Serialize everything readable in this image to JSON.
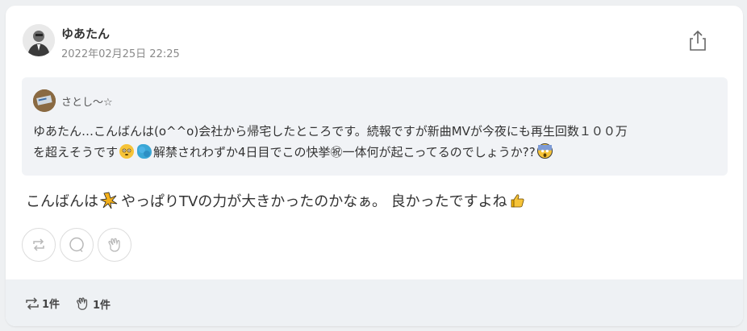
{
  "post": {
    "author_name": "ゆあたん",
    "date": "2022年02月25日 22:25",
    "reply_text_a": "こんばんは",
    "reply_text_b": "やっぱりTVの力が大きかったのかなぁ。 良かったですよね"
  },
  "quote": {
    "author_name": "さとし～☆",
    "text_line1": "ゆあたん…こんばんは(o^^o)会社から帰宅したところです。続報ですが新曲MVが今夜にも再生回数１００万",
    "text_line2_a": "を超えそうです",
    "text_line2_b": "解禁されわずか4日目でこの快挙㊗一体何が起こってるのでしょうか??"
  },
  "actions": {
    "icons": [
      "repost-icon",
      "comment-icon",
      "clap-icon"
    ]
  },
  "stats": {
    "repost_count": "1件",
    "clap_count": "1件"
  },
  "colors": {
    "background": "#eef0f2",
    "card": "#ffffff",
    "quote_bg": "#f1f3f6",
    "footer_bg": "#eef1f4"
  }
}
